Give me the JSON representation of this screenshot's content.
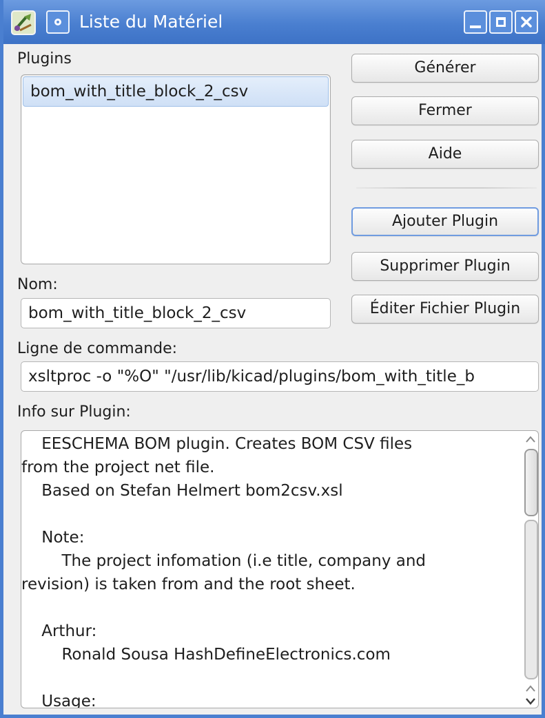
{
  "window": {
    "title": "Liste du Matériel",
    "accent": "#4a7fd0"
  },
  "labels": {
    "plugins": "Plugins",
    "name": "Nom:",
    "command": "Ligne de commande:",
    "info": "Info sur Plugin:"
  },
  "plugins_list": [
    {
      "label": "bom_with_title_block_2_csv",
      "selected": true
    }
  ],
  "buttons": {
    "generate": "Générer",
    "close": "Fermer",
    "help": "Aide",
    "add_plugin": "Ajouter Plugin",
    "remove_plugin": "Supprimer Plugin",
    "edit_plugin": "Éditer Fichier Plugin"
  },
  "fields": {
    "name_value": "bom_with_title_block_2_csv",
    "command_value": "xsltproc -o \"%O\" \"/usr/lib/kicad/plugins/bom_with_title_b"
  },
  "info_text": "    EESCHEMA BOM plugin. Creates BOM CSV files\nfrom the project net file.\n    Based on Stefan Helmert bom2csv.xsl\n\n    Note:\n        The project infomation (i.e title, company and\nrevision) is taken from and the root sheet.\n\n    Arthur:\n        Ronald Sousa HashDefineElectronics.com\n\n    Usage:"
}
